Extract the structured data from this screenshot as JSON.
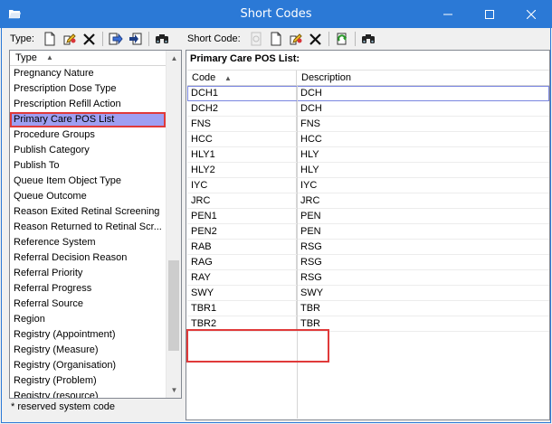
{
  "window": {
    "title": "Short Codes",
    "minimize_glyph": "—",
    "maximize_glyph": "☐",
    "close_glyph": "✕"
  },
  "left_toolbar": {
    "label": "Type:",
    "buttons": [
      "new-document-icon",
      "edit-icon",
      "delete-icon",
      "export-icon",
      "import-icon",
      "find-icon"
    ]
  },
  "right_toolbar": {
    "label": "Short Code:",
    "buttons": [
      "properties-icon",
      "new-document-icon",
      "edit-icon",
      "delete-icon",
      "refresh-icon",
      "find-icon"
    ]
  },
  "type_list": {
    "header": "Type",
    "items": [
      "Pregnancy Nature",
      "Prescription Dose Type",
      "Prescription Refill Action",
      "Primary Care POS List",
      "Procedure Groups",
      "Publish Category",
      "Publish To",
      "Queue Item Object Type",
      "Queue Outcome",
      "Reason Exited Retinal Screening",
      "Reason Returned to Retinal Scr...",
      "Reference System",
      "Referral Decision Reason",
      "Referral Priority",
      "Referral Progress",
      "Referral Source",
      "Region",
      "Registry (Appointment)",
      "Registry (Measure)",
      "Registry (Organisation)",
      "Registry (Problem)",
      "Registry (resource)"
    ],
    "selected": "Primary Care POS List"
  },
  "footnote": "* reserved system code",
  "codes_panel": {
    "title": "Primary Care POS List:",
    "col_code": "Code",
    "col_desc": "Description",
    "rows": [
      {
        "code": "DCH1",
        "desc": "DCH"
      },
      {
        "code": "DCH2",
        "desc": "DCH"
      },
      {
        "code": "FNS",
        "desc": "FNS"
      },
      {
        "code": "HCC",
        "desc": "HCC"
      },
      {
        "code": "HLY1",
        "desc": "HLY"
      },
      {
        "code": "HLY2",
        "desc": "HLY"
      },
      {
        "code": "IYC",
        "desc": "IYC"
      },
      {
        "code": "JRC",
        "desc": "JRC"
      },
      {
        "code": "PEN1",
        "desc": "PEN"
      },
      {
        "code": "PEN2",
        "desc": "PEN"
      },
      {
        "code": "RAB",
        "desc": "RSG"
      },
      {
        "code": "RAG",
        "desc": "RSG"
      },
      {
        "code": "RAY",
        "desc": "RSG"
      },
      {
        "code": "SWY",
        "desc": "SWY"
      },
      {
        "code": "TBR1",
        "desc": "TBR"
      },
      {
        "code": "TBR2",
        "desc": "TBR"
      }
    ]
  },
  "colors": {
    "titlebar": "#2b79d6",
    "selection": "#9e9ff2",
    "highlight_box": "#e03a3a"
  }
}
